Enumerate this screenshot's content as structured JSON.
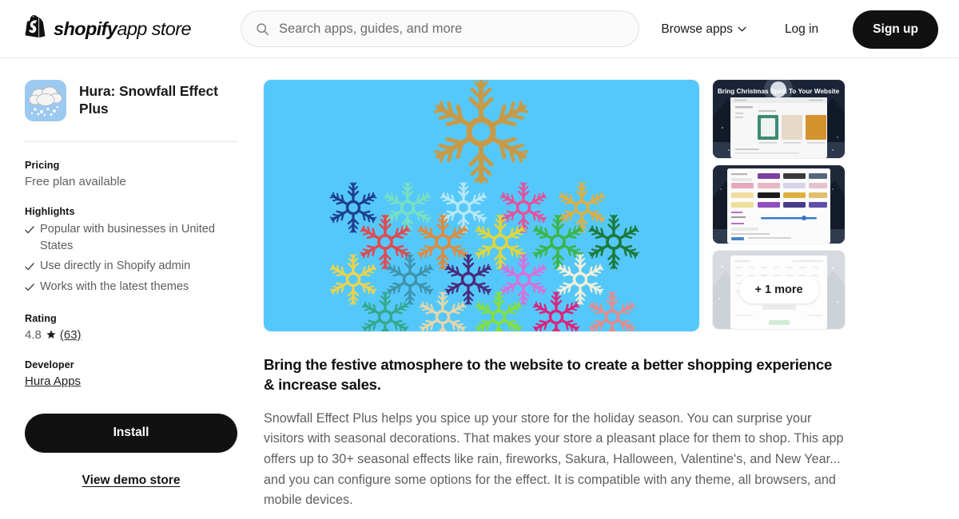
{
  "header": {
    "logo_text_bold": "shopify",
    "logo_text_light": "app store",
    "logo_icon": "shopify-bag-icon",
    "search": {
      "placeholder": "Search apps, guides, and more",
      "value": "",
      "icon": "search-icon"
    },
    "browse_apps": "Browse apps",
    "browse_apps_icon": "chevron-down-icon",
    "log_in": "Log in",
    "sign_up": "Sign up",
    "signup_bg": "#111111"
  },
  "sidebar": {
    "app_icon": "snow-cloud-icon",
    "app_title": "Hura: Snowfall Effect Plus",
    "pricing": {
      "label": "Pricing",
      "value": "Free plan available"
    },
    "highlights": {
      "label": "Highlights",
      "items": [
        "Popular with businesses in United States",
        "Use directly in Shopify admin",
        "Works with the latest themes"
      ],
      "bullet_icon": "check-icon"
    },
    "rating": {
      "label": "Rating",
      "score": "4.8",
      "star_icon": "star-icon",
      "count": "(63)"
    },
    "developer": {
      "label": "Developer",
      "name": "Hura Apps"
    },
    "install_button": "Install",
    "demo_link": "View demo store"
  },
  "gallery": {
    "hero": {
      "name": "snowflakes-hero-image",
      "background_color": "#55c8fb",
      "big_snowflake_color": "#c79a47",
      "rows": [
        [
          "#1f3f8f",
          "#79e0c0",
          "#b9e8f5",
          "#e8509a",
          "#e5ae3c"
        ],
        [
          "#e04a52",
          "#e08a3c",
          "#e0d63c",
          "#3cb54a",
          "#1c7a3c"
        ],
        [
          "#ecd34d",
          "#3f93ab",
          "#4a2a7a",
          "#d96fd9",
          "#f5f0d8"
        ],
        [
          "#34a88a",
          "#e6d7a8",
          "#86e034",
          "#e0207a",
          "#e88a8a"
        ]
      ]
    },
    "thumbnails": [
      {
        "name": "thumbnail-christmas-spirit",
        "caption": "Bring Christmas Spirit To Your Website"
      },
      {
        "name": "thumbnail-effects-picker",
        "caption": ""
      },
      {
        "name": "thumbnail-more",
        "caption": "",
        "overlay_label": "+ 1 more"
      }
    ]
  },
  "content": {
    "tagline": "Bring the festive atmosphere to the website to create a better shopping experience & increase sales.",
    "description": "Snowfall Effect Plus helps you spice up your store for the holiday season. You can surprise your visitors with seasonal decorations. That makes your store a pleasant place for them to shop. This app offers up to 30+ seasonal effects like rain, fireworks, Sakura, Halloween, Valentine's, and New Year... and you can configure some options for the effect. It is compatible with any theme, all browsers, and mobile devices."
  }
}
